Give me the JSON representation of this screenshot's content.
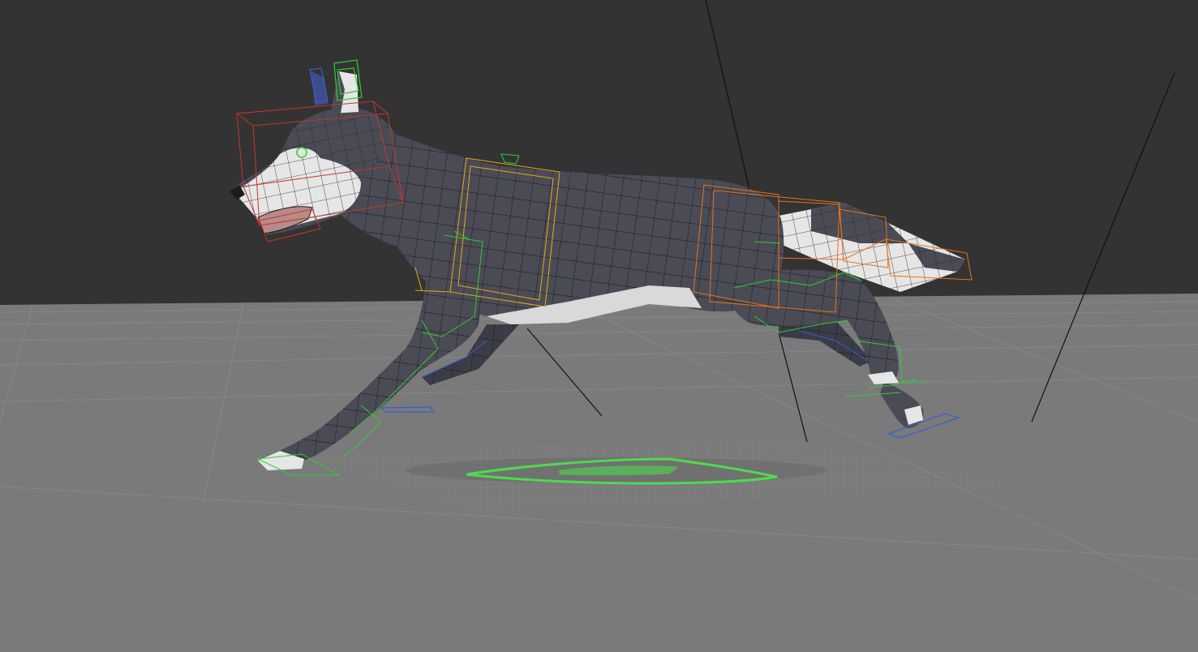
{
  "viewport": {
    "background_color": "#333333",
    "ground_color": "#7a7a7a",
    "grid_color": "#8a8a8a",
    "mesh_dark_color": "#4a4b55",
    "mesh_light_color": "#e6e6e6",
    "wire_color": "#1a1a1a",
    "controls": {
      "head_color": "#c0392b",
      "spine_color": "#e6a817",
      "hip_tail_color": "#e8731a",
      "limb_color": "#33cc33",
      "foot_ik_color": "#3a5fcf",
      "root_color": "#4ddb4d"
    }
  }
}
